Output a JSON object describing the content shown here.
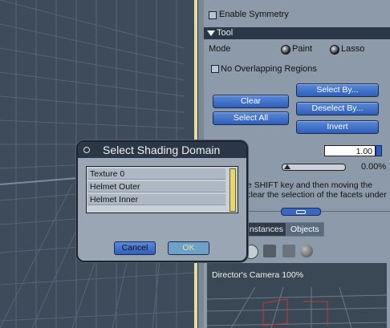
{
  "panel": {
    "enable_symmetry": "Enable Symmetry",
    "tool_header": "Tool",
    "mode_label": "Mode",
    "mode_paint": "Paint",
    "mode_lasso": "Lasso",
    "no_overlapping": "No Overlapping Regions",
    "clear": "Clear",
    "select_all": "Select All",
    "select_by": "Select By...",
    "deselect_by": "Deselect By...",
    "invert": "Invert",
    "value": "1.00",
    "percent": "0.00%",
    "help_line1": "he SHIFT key and then moving the",
    "help_line2": "l clear the selection of the facets under",
    "tab_instances": "Instances",
    "tab_objects": "Objects",
    "camera_label": "Director's Camera 100%"
  },
  "dialog": {
    "title": "Select Shading Domain",
    "items": [
      "Texture 0",
      "Helmet Outer",
      "Helmet Inner"
    ],
    "cancel": "Cancel",
    "ok": "OK"
  },
  "colors": {
    "button_blue": "#3b67c4",
    "ok_disabled": "#6fa0c8",
    "accent_yellow": "#e4dca0"
  }
}
